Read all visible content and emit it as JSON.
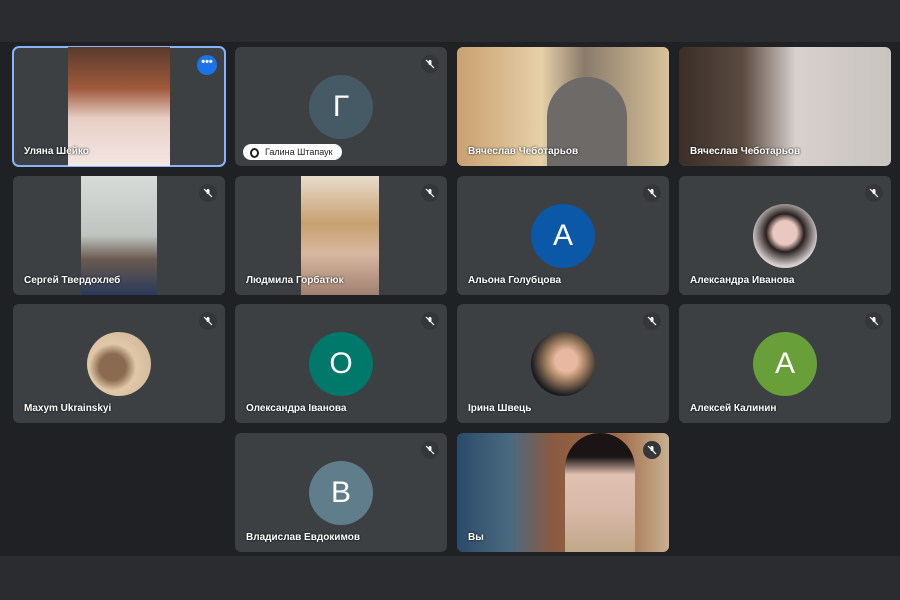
{
  "participants": [
    {
      "name": "Уляна Шейко",
      "type": "video"
    },
    {
      "name": "Галина Штапаук",
      "initial": "Г",
      "color": "#455a64",
      "muted": true
    },
    {
      "name": "Вячеслав Чеботарьов",
      "type": "video"
    },
    {
      "name": "Вячеслав Чеботарьов",
      "type": "video"
    },
    {
      "name": "Сергей Твердохлеб",
      "type": "video",
      "muted": true
    },
    {
      "name": "Людмила Горбатюк",
      "type": "video",
      "muted": true
    },
    {
      "name": "Альона Голубцова",
      "initial": "А",
      "color": "#0b57a8",
      "muted": true
    },
    {
      "name": "Александра Иванова",
      "type": "photo",
      "muted": true
    },
    {
      "name": "Maxym Ukrainskyi",
      "type": "photo",
      "muted": true
    },
    {
      "name": "Олександра Іванова",
      "initial": "О",
      "color": "#00796b",
      "muted": true
    },
    {
      "name": "Ірина Швець",
      "type": "photo",
      "muted": true
    },
    {
      "name": "Алексей Калинин",
      "initial": "А",
      "color": "#689f38",
      "muted": true
    },
    {
      "name": "Владислав Евдокимов",
      "initial": "В",
      "color": "#607d8b",
      "muted": true
    },
    {
      "name": "Вы",
      "type": "video",
      "muted": true
    }
  ],
  "more_options_label": "•••",
  "colors": {
    "accent": "#1a73e8",
    "tile": "#3c4043",
    "bg": "#202124"
  }
}
